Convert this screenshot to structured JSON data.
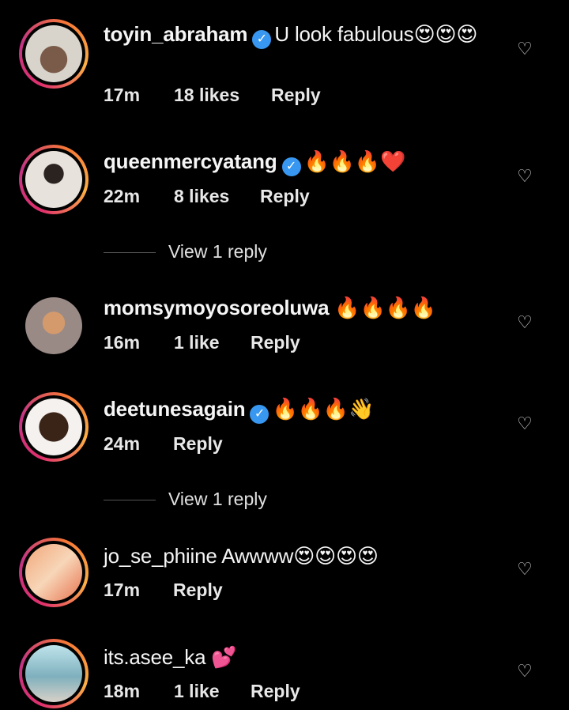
{
  "comments": [
    {
      "username": "toyin_abraham",
      "verified": true,
      "text": "U look fabulous",
      "emoji": "😍😍😍",
      "time": "17m",
      "likes": "18 likes",
      "reply": "Reply",
      "view_replies": null,
      "ring": true
    },
    {
      "username": "queenmercyatang",
      "verified": true,
      "text": "",
      "emoji": "🔥🔥🔥❤️",
      "time": "22m",
      "likes": "8 likes",
      "reply": "Reply",
      "view_replies": "View 1 reply",
      "ring": true
    },
    {
      "username": "momsymoyosoreoluwa",
      "verified": false,
      "text": "",
      "emoji": "🔥🔥🔥🔥",
      "time": "16m",
      "likes": "1 like",
      "reply": "Reply",
      "view_replies": null,
      "ring": false
    },
    {
      "username": "deetunesagain",
      "verified": true,
      "text": "",
      "emoji": "🔥🔥🔥👋",
      "time": "24m",
      "likes": "",
      "reply": "Reply",
      "view_replies": "View 1 reply",
      "ring": true
    },
    {
      "username": "jo_se_phiine",
      "verified": false,
      "text": "Awwww",
      "emoji": "😍😍😍😍",
      "time": "17m",
      "likes": "",
      "reply": "Reply",
      "view_replies": null,
      "ring": true
    },
    {
      "username": "its.asee_ka",
      "verified": false,
      "text": "",
      "emoji": "💕",
      "time": "18m",
      "likes": "1 like",
      "reply": "Reply",
      "view_replies": null,
      "ring": true
    }
  ],
  "icons": {
    "like": "heart-outline-icon",
    "verified": "verified-badge-icon"
  },
  "colors": {
    "background": "#000000",
    "verified": "#3897f0",
    "ring": "#e1306c"
  }
}
